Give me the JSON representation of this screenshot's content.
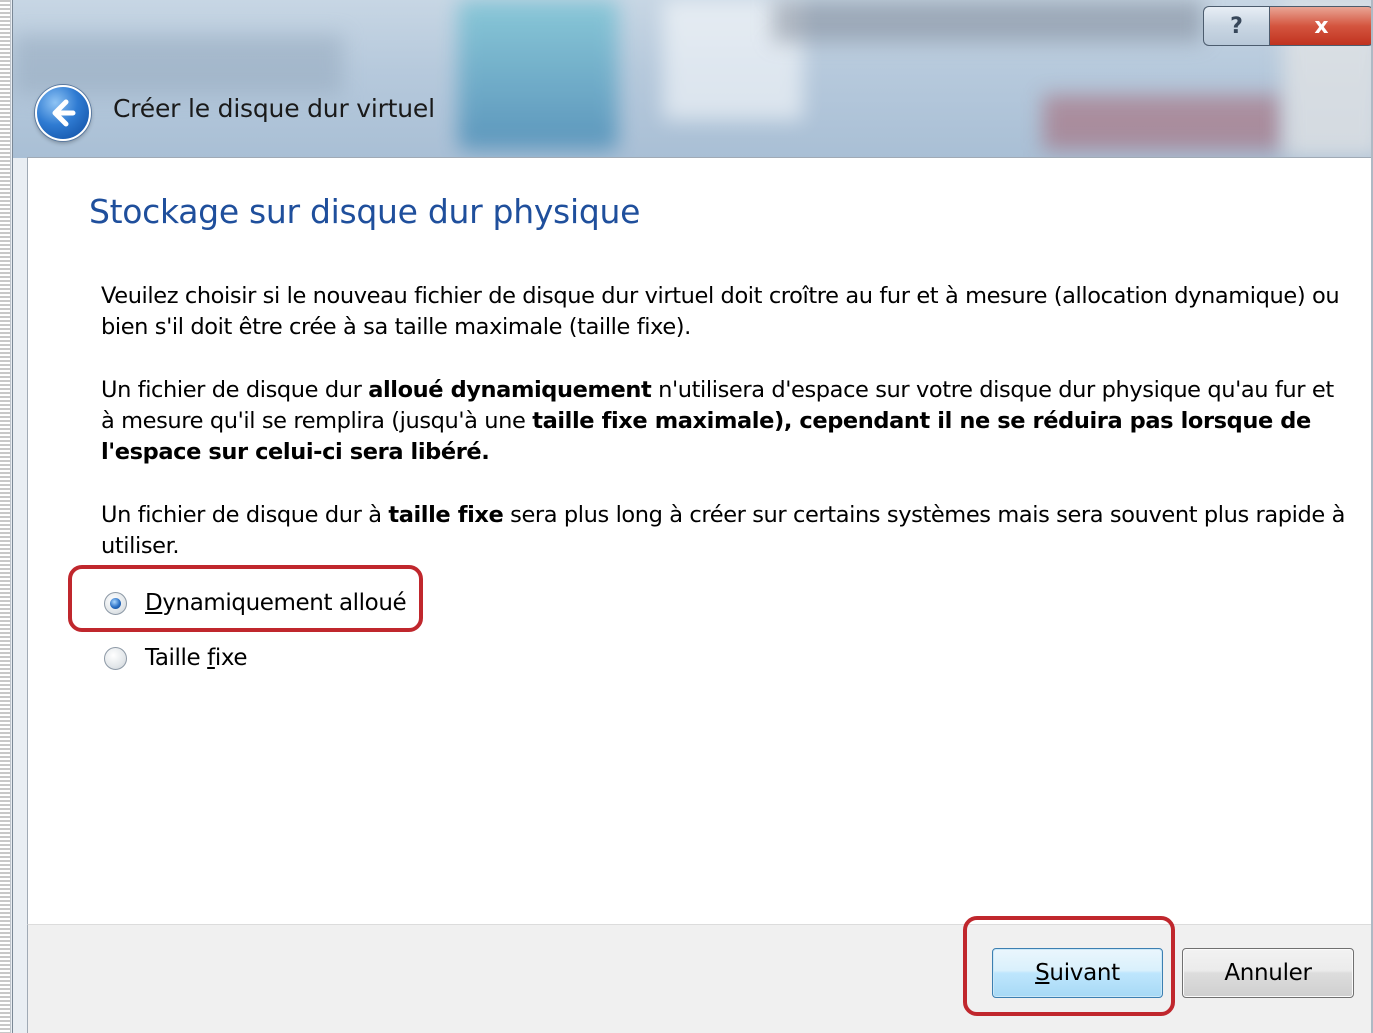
{
  "window": {
    "title": "Créer le disque dur virtuel",
    "help_label": "?",
    "close_label": "x"
  },
  "page": {
    "heading": "Stockage sur disque dur physique",
    "paragraph1": "Veuilez choisir si le nouveau fichier de disque dur virtuel doit croître au fur et à mesure (allocation dynamique) ou bien s'il doit être crée à sa taille maximale (taille fixe).",
    "paragraph2": {
      "part1": "Un fichier de disque dur ",
      "bold1": "alloué dynamiquement",
      "part2": " n'utilisera d'espace sur votre disque dur physique qu'au fur et à mesure qu'il se remplira (jusqu'à une ",
      "bold2": "taille fixe maximale), cependant il ne se réduira pas lorsque de l'espace sur celui-ci sera libéré."
    },
    "paragraph3": {
      "part1": "Un fichier de disque dur à ",
      "bold1": "taille fixe",
      "part2": " sera plus long à créer sur certains systèmes mais sera souvent plus rapide à utiliser."
    }
  },
  "options": [
    {
      "label_prefix": "",
      "label_mnemonic": "D",
      "label_rest": "ynamiquement alloué",
      "selected": true
    },
    {
      "label_prefix": "Taille ",
      "label_mnemonic": "f",
      "label_rest": "ixe",
      "selected": false
    }
  ],
  "buttons": {
    "next": {
      "mnemonic": "S",
      "rest": "uivant"
    },
    "cancel": "Annuler"
  },
  "colors": {
    "heading": "#1f4f9c",
    "highlight": "#c0272d",
    "default_button_border": "#3c7fb1"
  },
  "icons": [
    "back-arrow-icon",
    "help-icon",
    "close-icon",
    "radio-selected-icon",
    "radio-unselected-icon"
  ]
}
